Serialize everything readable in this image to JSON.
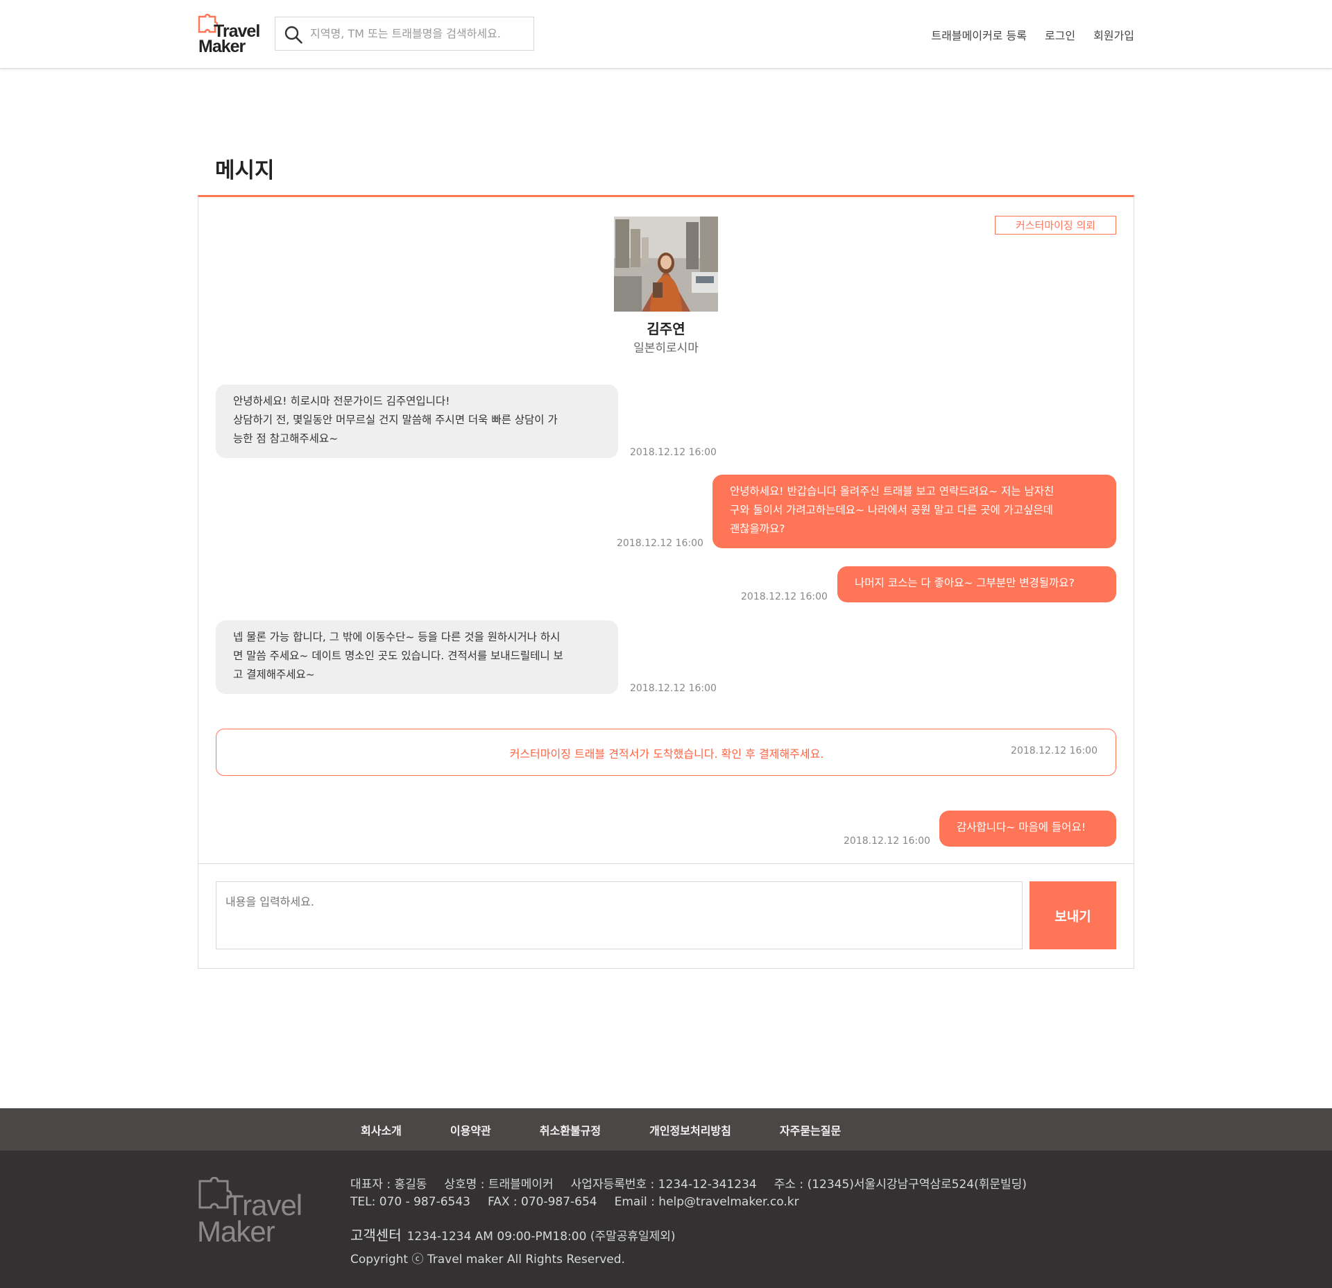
{
  "header": {
    "logo_line1": "Travel",
    "logo_line2": "Maker",
    "search_placeholder": "지역명, TM 또는 트래블명을 검색하세요.",
    "nav": [
      "트래블메이커로 등록",
      "로그인",
      "회원가입"
    ]
  },
  "page": {
    "title": "메시지"
  },
  "panel": {
    "custom_request_label": "커스터마이징 의뢰",
    "profile": {
      "name": "김주연",
      "location": "일본히로시마"
    },
    "messages": [
      {
        "side": "in",
        "lines": [
          "안녕하세요! 히로시마 전문가이드 김주연입니다!",
          "상담하기 전, 몇일동안 머무르실 건지 말씀해 주시면 더욱 빠른 상담이 가",
          "능한 점 참고해주세요~"
        ],
        "time": "2018.12.12 16:00"
      },
      {
        "side": "out",
        "lines": [
          "안녕하세요! 반갑습니다 올려주신 트래블 보고 연락드려요~ 저는 남자친",
          "구와 둘이서 가려고하는데요~ 나라에서 공원 말고 다른 곳에 가고싶은데",
          "괜찮을까요?"
        ],
        "time": "2018.12.12 16:00"
      },
      {
        "side": "out",
        "lines": [
          "나머지 코스는 다 좋아요~ 그부분만 변경될까요?"
        ],
        "time": "2018.12.12 16:00"
      },
      {
        "side": "in",
        "lines": [
          "넵 물론 가능 합니다, 그 밖에 이동수단~ 등을 다른 것을 원하시거나 하시",
          "면 말씀 주세요~ 데이트 명소인 곳도 있습니다. 견적서를 보내드릴테니 보",
          "고 결제해주세요~"
        ],
        "time": "2018.12.12 16:00"
      }
    ],
    "notice": {
      "text": "커스터마이징 트래블 견적서가 도착했습니다. 확인 후 결제해주세요.",
      "time": "2018.12.12 16:00"
    },
    "last_message": {
      "side": "out",
      "lines": [
        "감사합니다~ 마음에 들어요!"
      ],
      "time": "2018.12.12 16:00"
    },
    "input_placeholder": "내용을 입력하세요.",
    "send_label": "보내기"
  },
  "footer": {
    "links": [
      "회사소개",
      "이용약관",
      "취소환불규정",
      "개인정보처리방침",
      "자주묻는질문"
    ],
    "logo_line1": "Travel",
    "logo_line2": "Maker",
    "info_line1": [
      "대표자 : 홍길동",
      "상호명 : 트래블메이커",
      "사업자등록번호 : 1234-12-341234",
      "주소 : (12345)서울시강남구역삼로524(휘문빌딩)"
    ],
    "info_line2": [
      "TEL: 070 - 987-6543",
      "FAX : 070-987-654",
      "Email : help@travelmaker.co.kr"
    ],
    "cs_label": "고객센터",
    "cs_value": "1234-1234  AM 09:00-PM18:00 (주말공휴일제외)",
    "copyright": "Copyright ⓒ Travel maker All Rights Reserved."
  },
  "colors": {
    "accent": "#ff7558",
    "footer_nav_bg": "#4c4747",
    "footer_bg": "#333131",
    "bubble_in_bg": "#efefef"
  }
}
